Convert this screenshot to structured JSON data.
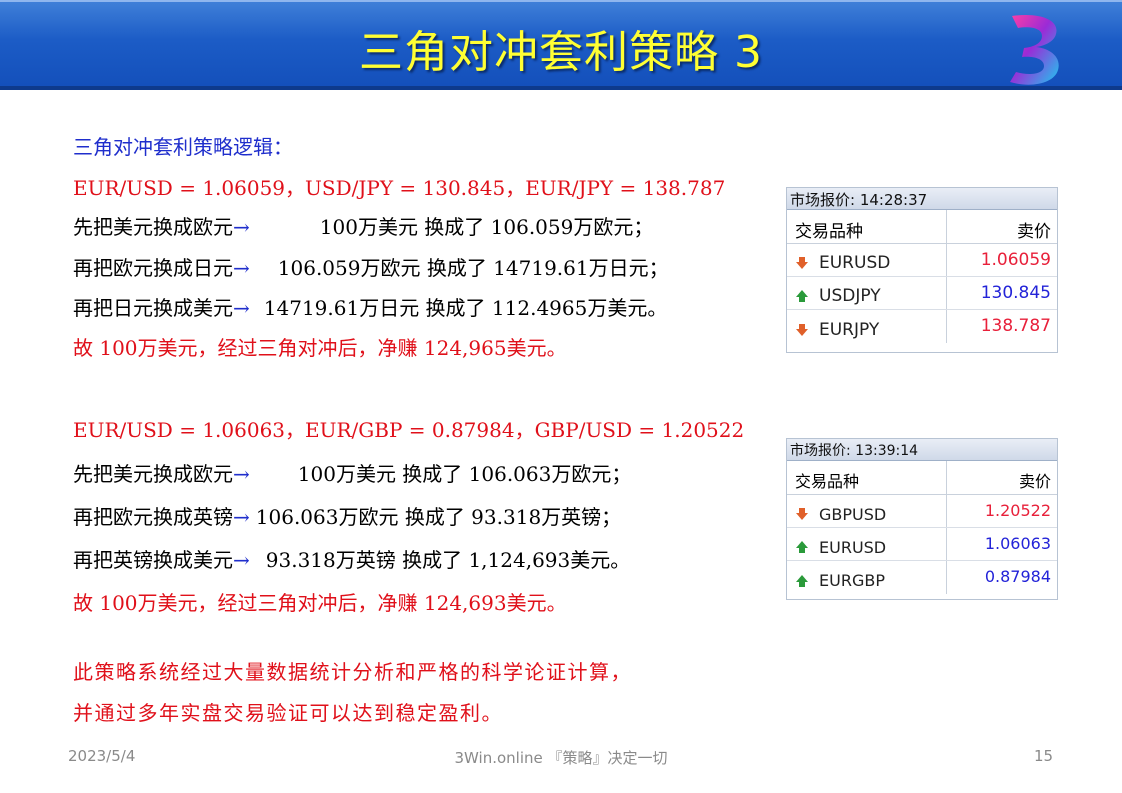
{
  "slide": {
    "title": "三角对冲套利策略 3",
    "logo_icon": "3win-logo-icon"
  },
  "section1": {
    "heading": "三角对冲套利策略逻辑：",
    "rates": "EUR/USD = 1.06059，USD/JPY = 130.845，EUR/JPY = 138.787",
    "steps": [
      {
        "left": "先把美元换成欧元",
        "right": "100万美元 换成了   106.059万欧元；"
      },
      {
        "left": "再把欧元换成日元",
        "right": "106.059万欧元 换成了  14719.61万日元；"
      },
      {
        "left": "再把日元换成美元",
        "right": "14719.61万日元 换成了  112.4965万美元。"
      }
    ],
    "conclusion": "故 100万美元，经过三角对冲后，净赚 124,965美元。"
  },
  "section2": {
    "rates": "EUR/USD = 1.06063，EUR/GBP = 0.87984，GBP/USD = 1.20522",
    "steps": [
      {
        "left": "先把美元换成欧元",
        "right": "100万美元 换成了 106.063万欧元；"
      },
      {
        "left": "再把欧元换成英镑",
        "right": "106.063万欧元 换成了   93.318万英镑；"
      },
      {
        "left": "再把英镑换成美元",
        "right": "93.318万英镑 换成了  1,124,693美元。"
      }
    ],
    "conclusion": "故 100万美元，经过三角对冲后，净赚 124,693美元。"
  },
  "closing": [
    "此策略系统经过大量数据统计分析和严格的科学论证计算，",
    "并通过多年实盘交易验证可以达到稳定盈利。"
  ],
  "arrow_glyph": "→",
  "quote_panel_1": {
    "header": "市场报价: 14:28:37",
    "col_symbol": "交易品种",
    "col_price": "卖价",
    "rows": [
      {
        "symbol": "EURUSD",
        "price": "1.06059",
        "direction": "down",
        "color": "#e8203a"
      },
      {
        "symbol": "USDJPY",
        "price": "130.845",
        "direction": "up",
        "color": "#2323d8"
      },
      {
        "symbol": "EURJPY",
        "price": "138.787",
        "direction": "down",
        "color": "#e8203a"
      }
    ]
  },
  "quote_panel_2": {
    "header": "市场报价: 13:39:14",
    "col_symbol": "交易品种",
    "col_price": "卖价",
    "rows": [
      {
        "symbol": "GBPUSD",
        "price": "1.20522",
        "direction": "down",
        "color": "#e8203a"
      },
      {
        "symbol": "EURUSD",
        "price": "1.06063",
        "direction": "up",
        "color": "#2323d8"
      },
      {
        "symbol": "EURGBP",
        "price": "0.87984",
        "direction": "up",
        "color": "#2323d8"
      }
    ]
  },
  "footer": {
    "date": "2023/5/4",
    "center": "3Win.online 『策略』决定一切",
    "page": "15"
  },
  "colors": {
    "title_text": "#ffff33",
    "heading_blue": "#1f2ecc",
    "alert_red": "#e0101a",
    "arrow_up": "#2a9a3a",
    "arrow_down": "#e0602a"
  }
}
